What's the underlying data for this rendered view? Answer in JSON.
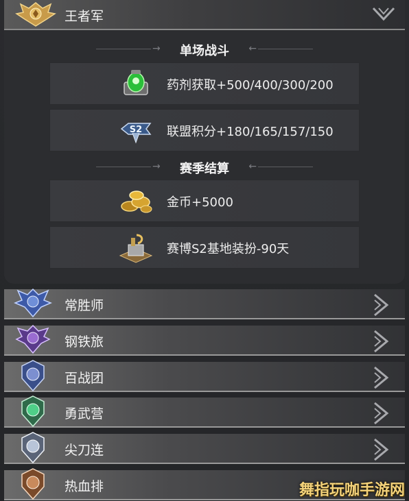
{
  "expanded_rank": {
    "title": "王者军",
    "badge_icon": "gold-wings-badge-icon",
    "toggle_icon": "chevron-down-icon"
  },
  "sections": [
    {
      "title": "单场战斗",
      "rewards": [
        {
          "icon": "potion-icon",
          "text": "药剂获取+500/400/300/200"
        },
        {
          "icon": "s2-alliance-icon",
          "text": "联盟积分+180/165/157/150"
        }
      ]
    },
    {
      "title": "赛季结算",
      "rewards": [
        {
          "icon": "gold-coins-icon",
          "text": "金币+5000"
        },
        {
          "icon": "base-decoration-icon",
          "text": "赛博S2基地装扮-90天"
        }
      ]
    }
  ],
  "ranks": [
    {
      "title": "常胜师",
      "color": "#6f8fd8"
    },
    {
      "title": "钢铁旅",
      "color": "#9a6cd0"
    },
    {
      "title": "百战团",
      "color": "#7c8fd0"
    },
    {
      "title": "勇武营",
      "color": "#4fcf88"
    },
    {
      "title": "尖刀连",
      "color": "#b8c4d8"
    },
    {
      "title": "热血排",
      "color": "#c88a5c"
    }
  ],
  "watermark": "舞指玩咖手游网"
}
